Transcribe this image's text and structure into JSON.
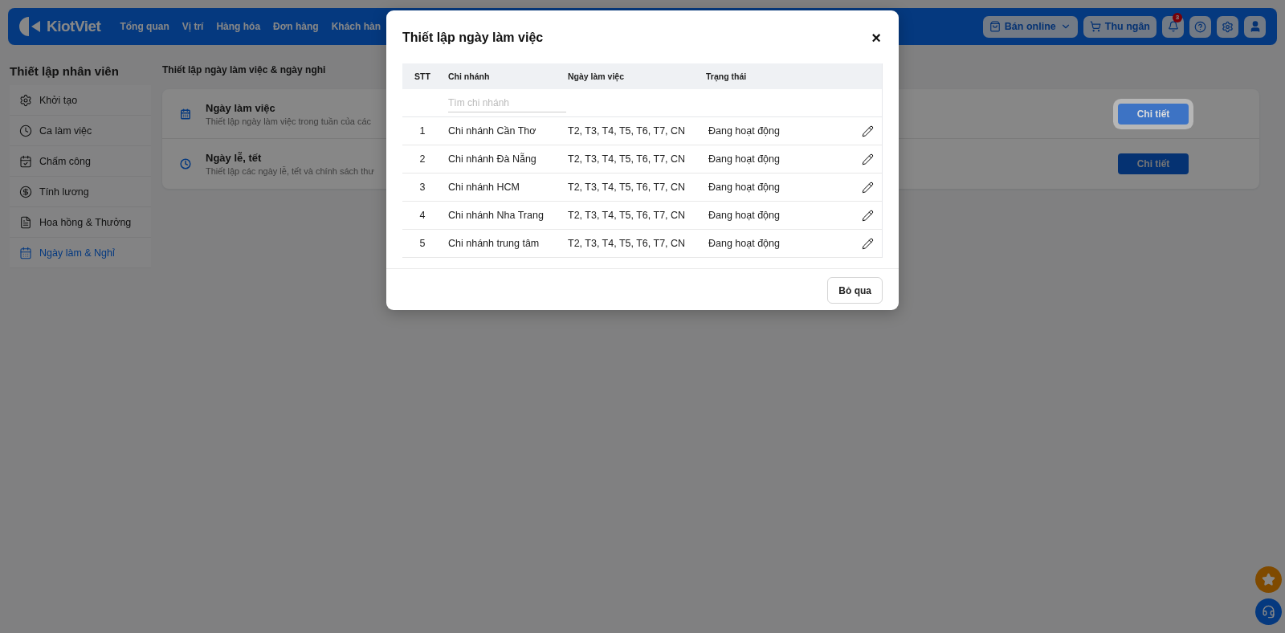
{
  "nav": {
    "logo": "KiotViet",
    "items": [
      "Tổng quan",
      "Vị trí",
      "Hàng hóa",
      "Đơn hàng",
      "Khách hàn"
    ],
    "actions": [
      {
        "kind": "online",
        "label": "Bán online"
      },
      {
        "kind": "cashier",
        "label": "Thu ngân"
      },
      {
        "kind": "bell",
        "badge": "3"
      },
      {
        "kind": "help"
      },
      {
        "kind": "settings"
      },
      {
        "kind": "avatar"
      }
    ]
  },
  "sidebar": {
    "title": "Thiết lập nhân viên",
    "items": [
      {
        "label": "Khởi tạo",
        "selected": false
      },
      {
        "label": "Ca làm việc",
        "selected": false
      },
      {
        "label": "Chấm công",
        "selected": false
      },
      {
        "label": "Tính lương",
        "selected": false
      },
      {
        "label": "Hoa hồng & Thưởng",
        "selected": false
      },
      {
        "label": "Ngày làm & Nghỉ",
        "selected": true
      }
    ]
  },
  "content": {
    "title": "Thiết lập ngày làm việc & ngày nghỉ",
    "cards": [
      {
        "title": "Ngày làm việc",
        "description": "Thiết lập ngày làm việc trong tuần của các",
        "button": "Chi tiết",
        "highlighted": true
      },
      {
        "title": "Ngày lễ, tết",
        "description": "Thiết lập các ngày lễ, tết và chính sách thư",
        "button": "Chi tiết",
        "highlighted": false
      }
    ]
  },
  "modal": {
    "title": "Thiết lập ngày làm việc",
    "close": "×",
    "table": {
      "columns": [
        "STT",
        "Chi nhánh",
        "Ngày làm việc",
        "Trạng thái"
      ],
      "search": {
        "placeholder": "Tìm chi nhánh"
      },
      "rows": [
        {
          "stt": "1",
          "branch": "Chi nhánh Cần Thơ",
          "days": "T2, T3, T4, T5, T6, T7, CN",
          "status": "Đang hoạt động"
        },
        {
          "stt": "2",
          "branch": "Chi nhánh Đà Nẵng",
          "days": "T2, T3, T4, T5, T6, T7, CN",
          "status": "Đang hoạt động"
        },
        {
          "stt": "3",
          "branch": "Chi nhánh HCM",
          "days": "T2, T3, T4, T5, T6, T7, CN",
          "status": "Đang hoạt động"
        },
        {
          "stt": "4",
          "branch": "Chi nhánh Nha Trang",
          "days": "T2, T3, T4, T5, T6, T7, CN",
          "status": "Đang hoạt động"
        },
        {
          "stt": "5",
          "branch": "Chi nhánh trung tâm",
          "days": "T2, T3, T4, T5, T6, T7, CN",
          "status": "Đang hoạt động"
        }
      ]
    },
    "footer_button": "Bỏ qua"
  }
}
